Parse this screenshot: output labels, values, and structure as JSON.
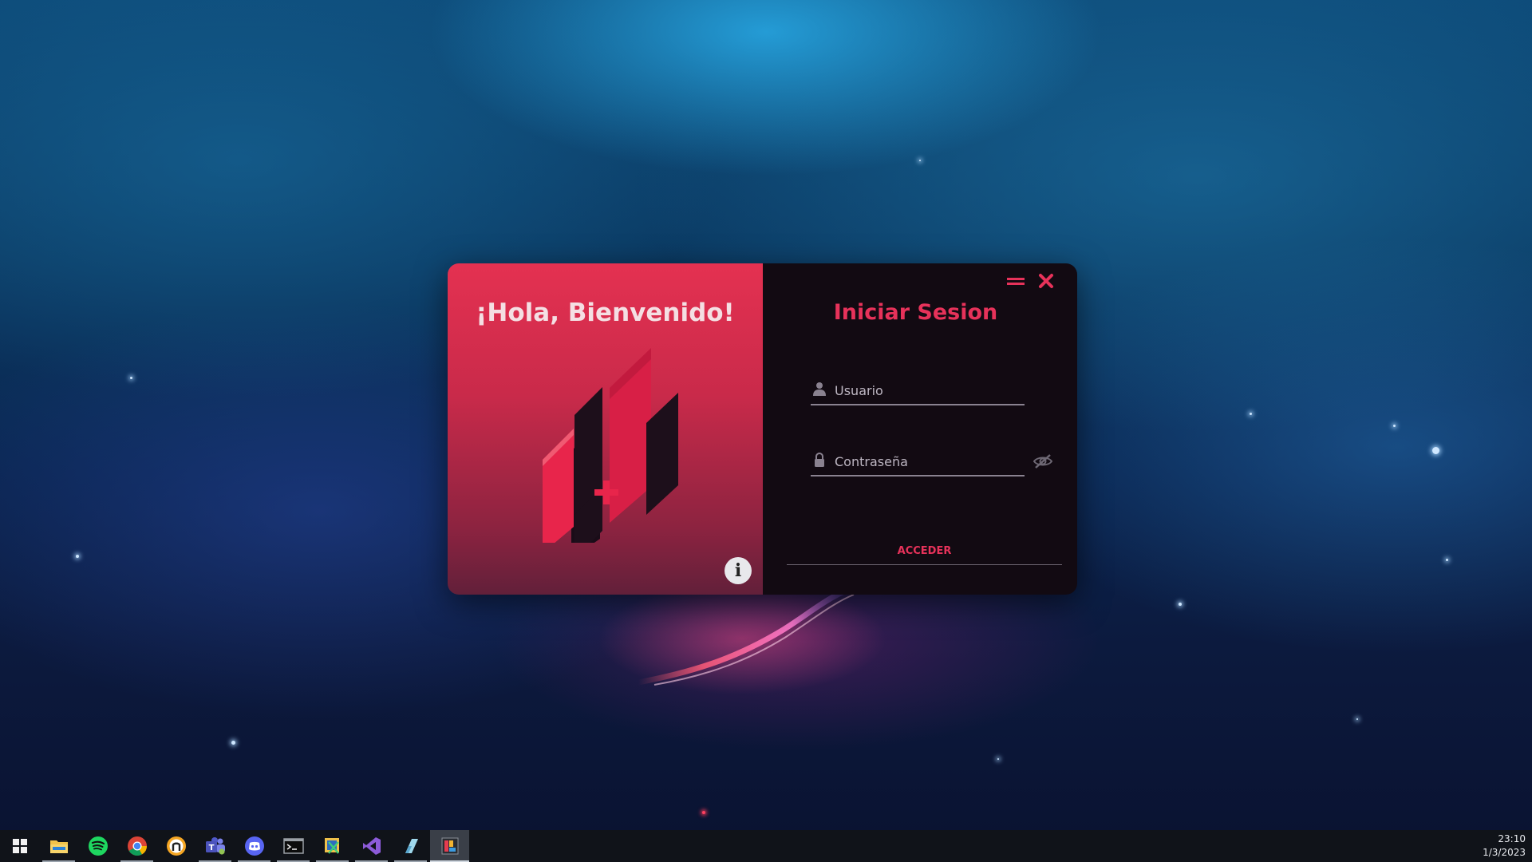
{
  "welcome_panel": {
    "title": "¡Hola, Bienvenido!",
    "info_button_icon": "info-icon",
    "logo_icon": "app-logo-icon"
  },
  "login_panel": {
    "title": "Iniciar Sesion",
    "window_buttons": {
      "minimize_icon": "minimize-icon",
      "close_icon": "close-icon"
    },
    "username": {
      "placeholder": "Usuario",
      "value": "",
      "icon": "user-icon"
    },
    "password": {
      "placeholder": "Contraseña",
      "value": "",
      "icon": "lock-icon",
      "toggle_icon": "eye-slash-icon"
    },
    "submit_label": "ACCEDER"
  },
  "taskbar": {
    "apps": [
      {
        "name": "windows-start",
        "running": false
      },
      {
        "name": "file-explorer",
        "running": true
      },
      {
        "name": "spotify",
        "running": false
      },
      {
        "name": "chrome",
        "running": true
      },
      {
        "name": "app-circle",
        "running": false
      },
      {
        "name": "teams",
        "running": true
      },
      {
        "name": "discord",
        "running": true
      },
      {
        "name": "terminal",
        "running": true
      },
      {
        "name": "snipping-tool",
        "running": true
      },
      {
        "name": "visual-studio",
        "running": true
      },
      {
        "name": "app-blue",
        "running": true
      },
      {
        "name": "active-app",
        "running": true,
        "active": true
      }
    ],
    "clock": {
      "time": "23:10",
      "date": "1/3/2023"
    }
  },
  "colors": {
    "accent": "#e7325a",
    "panel_dark": "#120a12",
    "gradient_top": "#e43151",
    "gradient_bottom": "#62203a"
  }
}
